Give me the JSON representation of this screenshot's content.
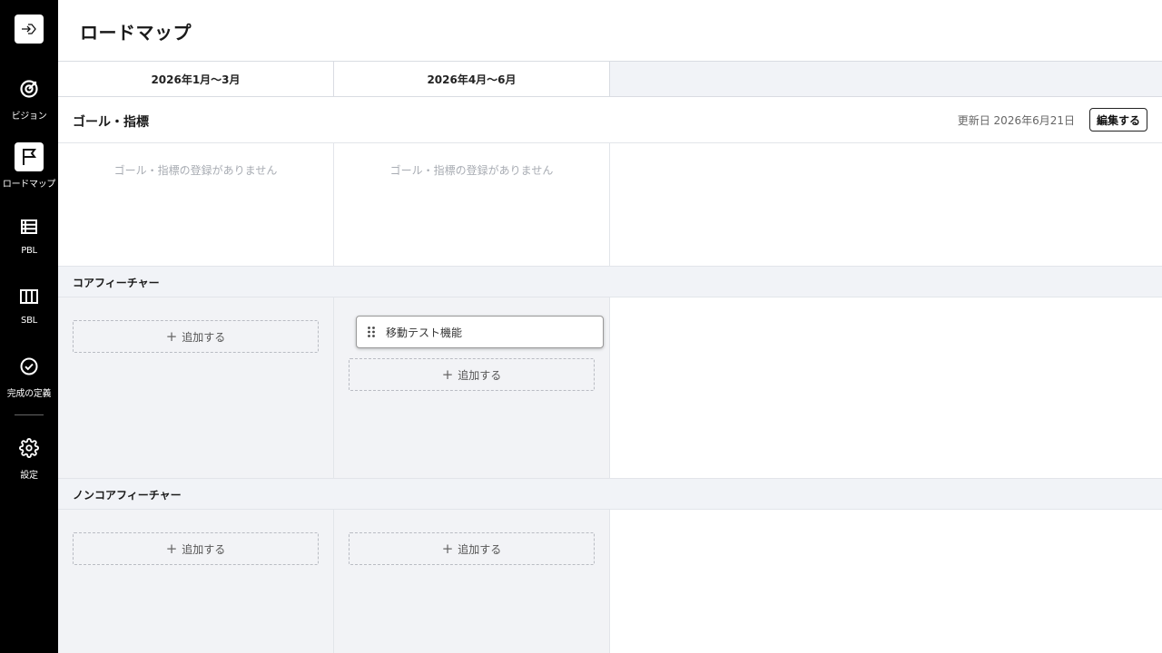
{
  "sidebar": {
    "items": [
      {
        "label": "ビジョン",
        "icon": "target-icon",
        "active": false
      },
      {
        "label": "ロードマップ",
        "icon": "flag-icon",
        "active": true
      },
      {
        "label": "PBL",
        "icon": "list-icon",
        "active": false
      },
      {
        "label": "SBL",
        "icon": "board-icon",
        "active": false
      },
      {
        "label": "完成の定義",
        "icon": "check-circle-icon",
        "active": false
      },
      {
        "label": "設定",
        "icon": "gear-icon",
        "active": false
      }
    ]
  },
  "page": {
    "title": "ロードマップ"
  },
  "quarters": [
    "2026年1月〜3月",
    "2026年4月〜6月"
  ],
  "goals": {
    "title": "ゴール・指標",
    "updated": "更新日 2026年6月21日",
    "edit_label": "編集する",
    "empty": [
      "ゴール・指標の登録がありません",
      "ゴール・指標の登録がありません"
    ]
  },
  "core": {
    "title": "コアフィーチャー",
    "add_label": "追加する",
    "features": [
      "移動テスト機能"
    ]
  },
  "noncore": {
    "title": "ノンコアフィーチャー",
    "add_label": "追加する"
  }
}
